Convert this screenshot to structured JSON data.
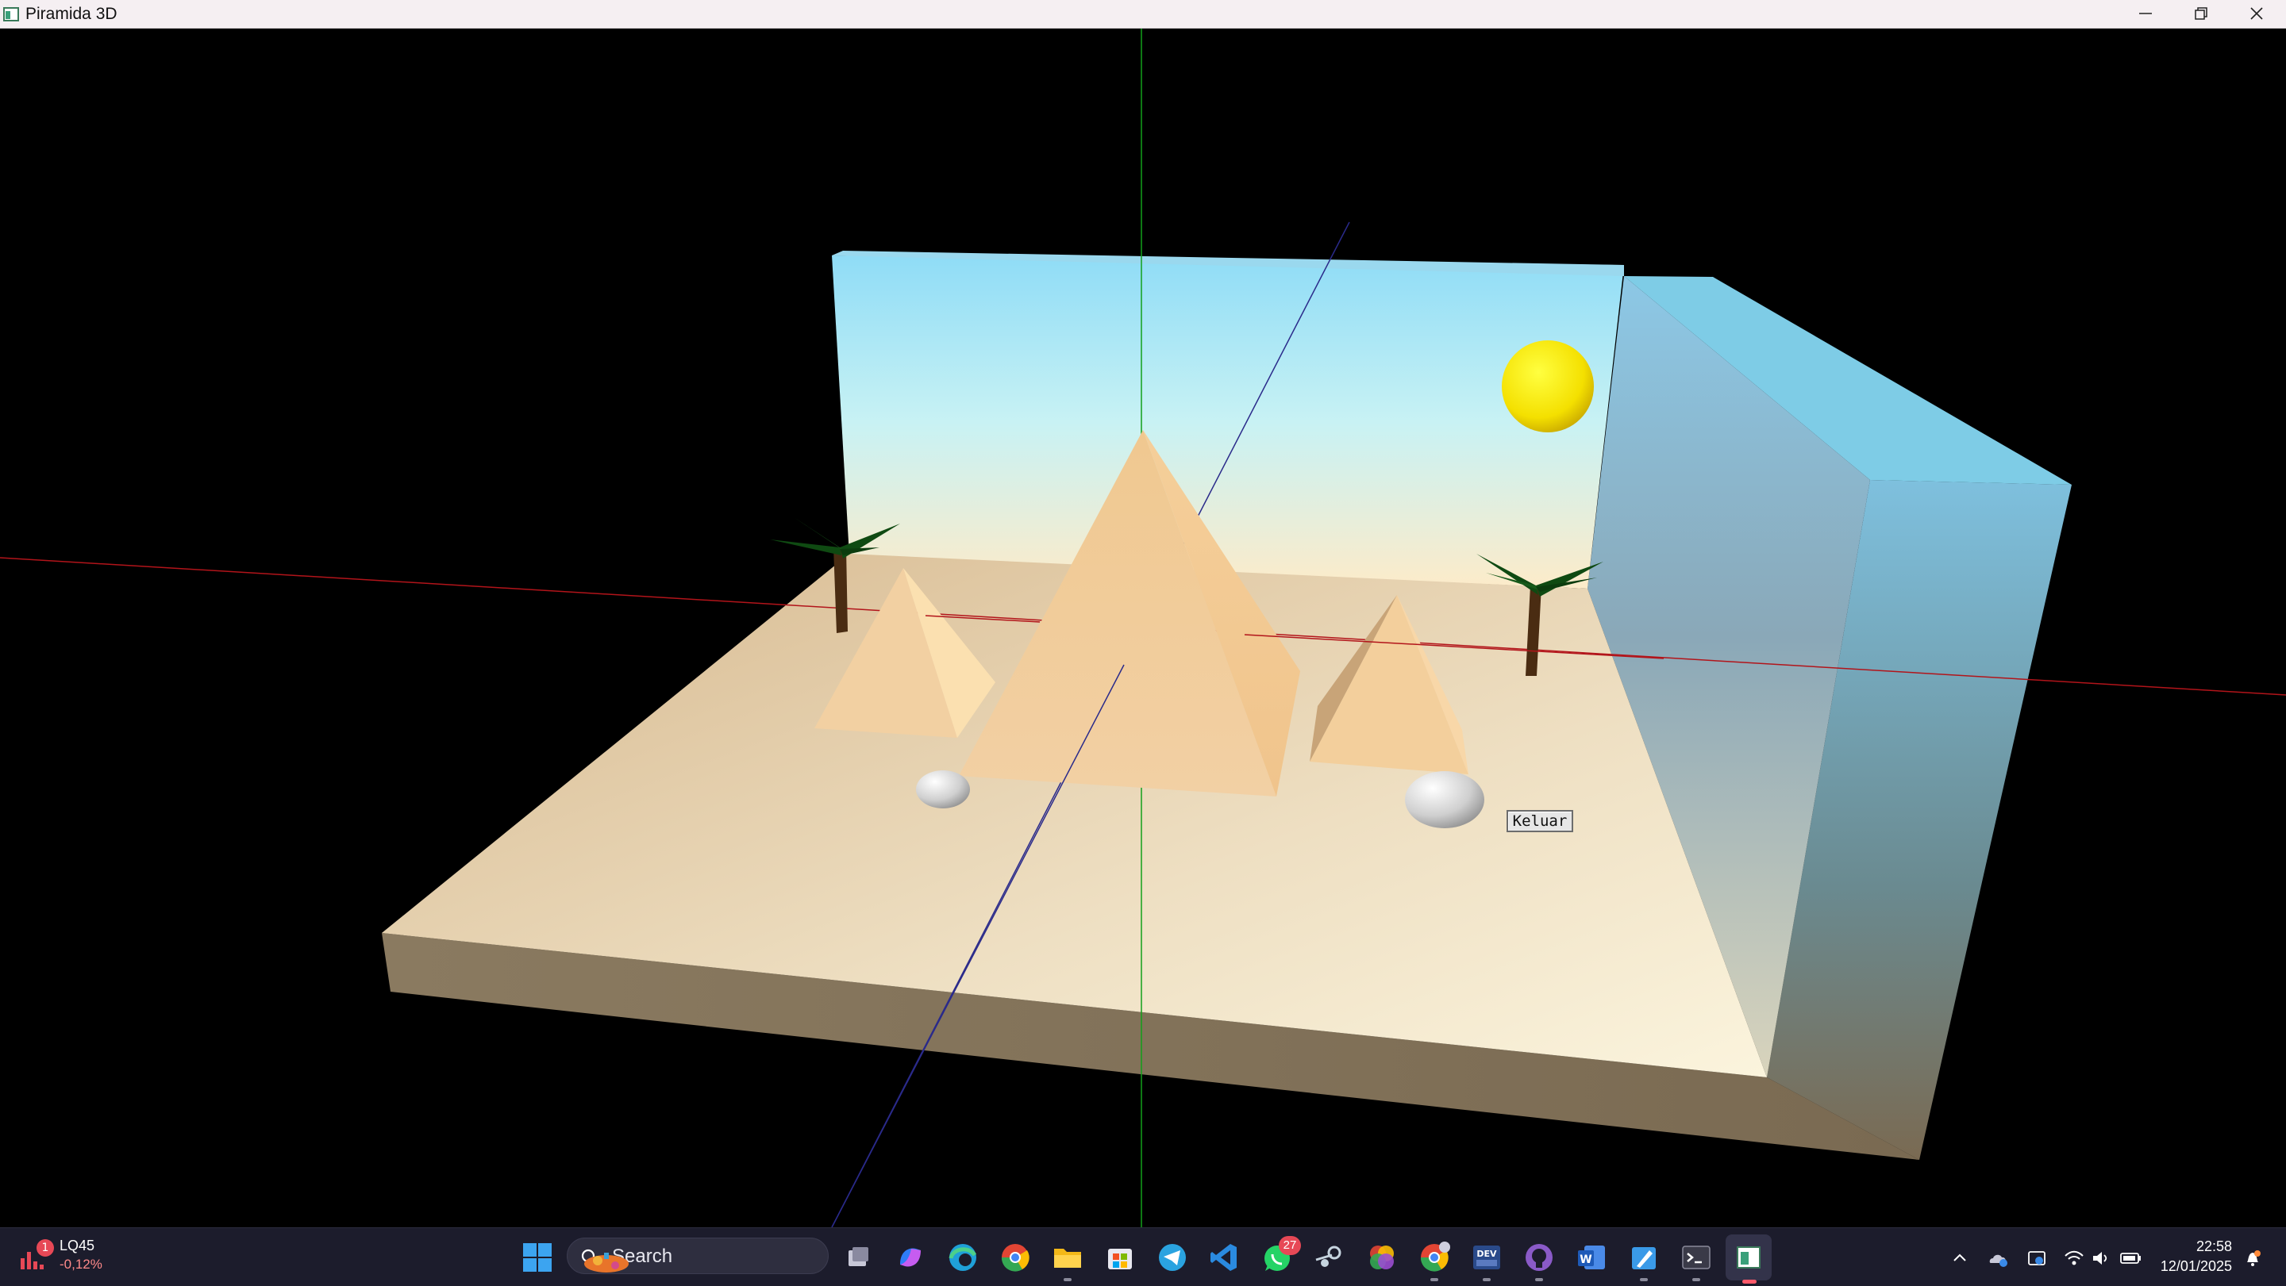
{
  "window": {
    "title": "Piramida 3D"
  },
  "scene": {
    "exit_button_label": "Keluar",
    "colors": {
      "background": "#000000",
      "sand": "#e8d2a8",
      "pyramid": "#f0c890",
      "sky_top": "#8fdcf6",
      "sky_bottom": "#fdebc9",
      "sun": "#f4e000",
      "palm_leaf": "#0f4a12",
      "palm_trunk": "#4a2c12",
      "axis_x": "#c0141a",
      "axis_y": "#12a01a",
      "axis_z": "#2a2a8a"
    }
  },
  "taskbar": {
    "stock": {
      "symbol": "LQ45",
      "change": "-0,12%",
      "alerts": "1"
    },
    "search_label": "Search",
    "whatsapp_badge": "27",
    "pinned": [
      "windows-start",
      "search",
      "task-view",
      "copilot",
      "edge",
      "chrome",
      "file-explorer",
      "microsoft-store",
      "telegram",
      "vscode",
      "whatsapp",
      "steam",
      "color-app",
      "chrome-profile",
      "dev-to",
      "github-desktop",
      "word",
      "paint-app",
      "terminal",
      "piramida-3d"
    ],
    "tray": {
      "time": "22:58",
      "date": "12/01/2025"
    }
  }
}
